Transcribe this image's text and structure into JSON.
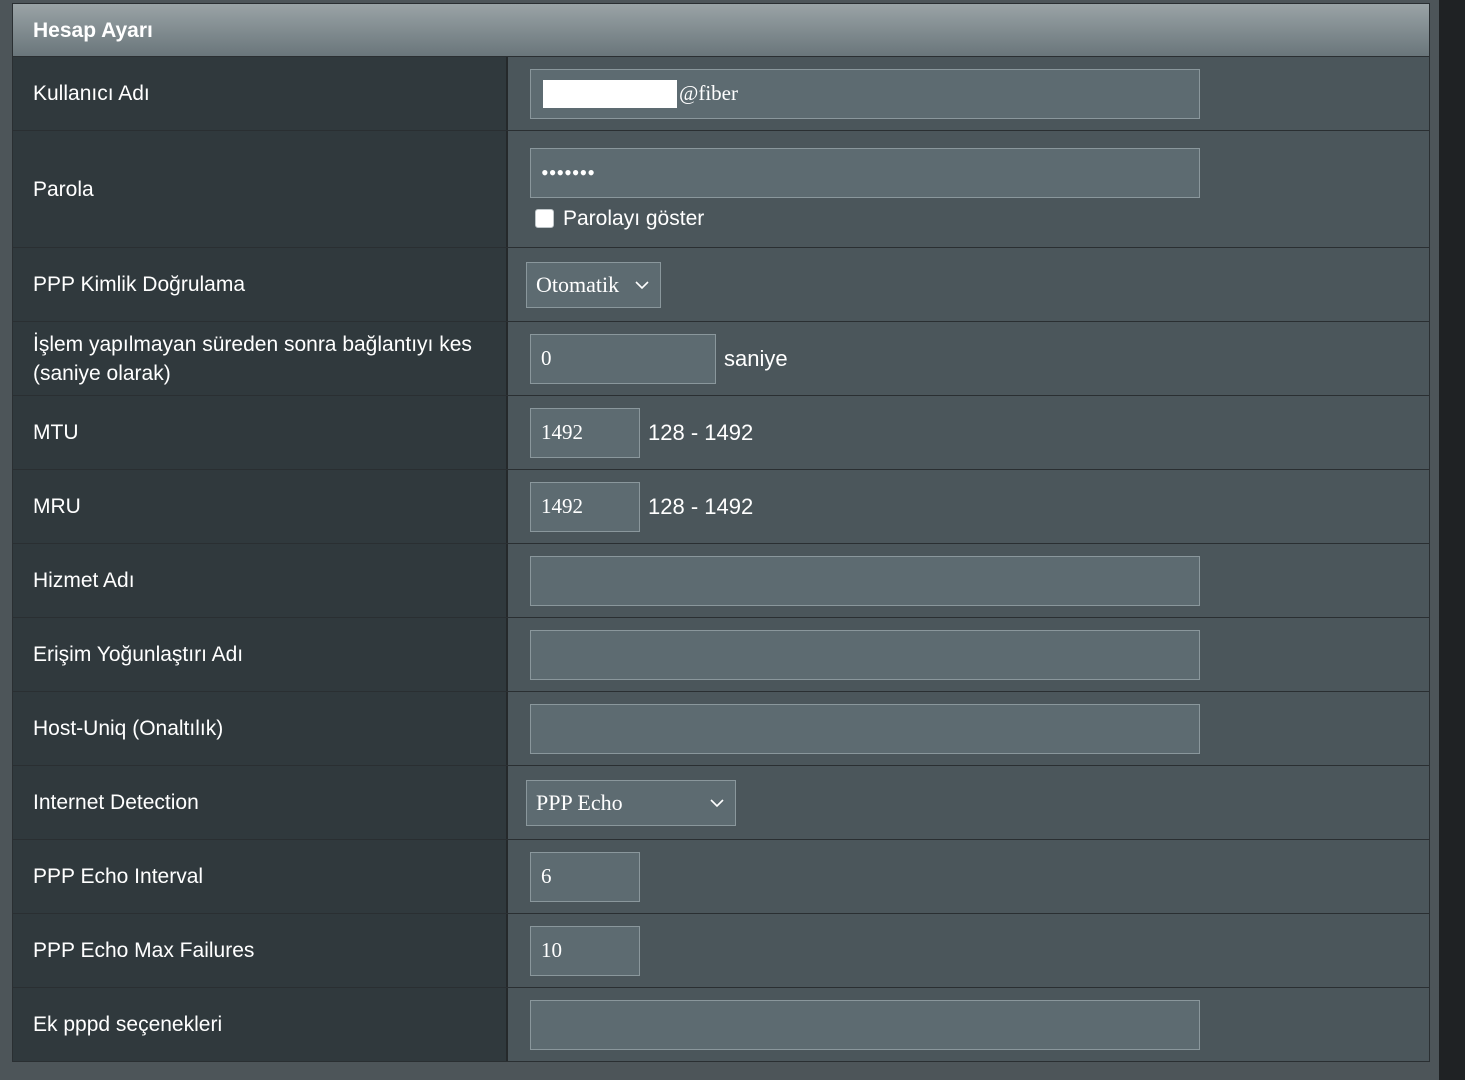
{
  "panel": {
    "title": "Hesap Ayarı"
  },
  "rows": {
    "username": {
      "label": "Kullanıcı Adı",
      "suffix": "@fiber"
    },
    "password": {
      "label": "Parola",
      "masked": "•••••••",
      "show_label": "Parolayı göster"
    },
    "ppp_auth": {
      "label": "PPP Kimlik Doğrulama",
      "selected": "Otomatik"
    },
    "idle": {
      "label": "İşlem yapılmayan süreden sonra bağlantıyı kes (saniye olarak)",
      "value": "0",
      "unit": "saniye"
    },
    "mtu": {
      "label": "MTU",
      "value": "1492",
      "range": "128 - 1492"
    },
    "mru": {
      "label": "MRU",
      "value": "1492",
      "range": "128 - 1492"
    },
    "service_name": {
      "label": "Hizmet Adı",
      "value": ""
    },
    "ac_name": {
      "label": "Erişim Yoğunlaştırı Adı",
      "value": ""
    },
    "host_uniq": {
      "label": "Host-Uniq (Onaltılık)",
      "value": ""
    },
    "internet_detection": {
      "label": "Internet Detection",
      "selected": "PPP Echo"
    },
    "echo_interval": {
      "label": "PPP Echo Interval",
      "value": "6"
    },
    "echo_max_failures": {
      "label": "PPP Echo Max Failures",
      "value": "10"
    },
    "pppd_options": {
      "label": "Ek pppd seçenekleri",
      "value": ""
    }
  },
  "icons": {
    "dropdown": "chevron-down-icon",
    "checkbox": "checkbox-unchecked"
  },
  "colors": {
    "label_bg": "#30393d",
    "value_bg": "#4b565b",
    "input_bg": "#5d6b71",
    "text": "#ffffff"
  }
}
